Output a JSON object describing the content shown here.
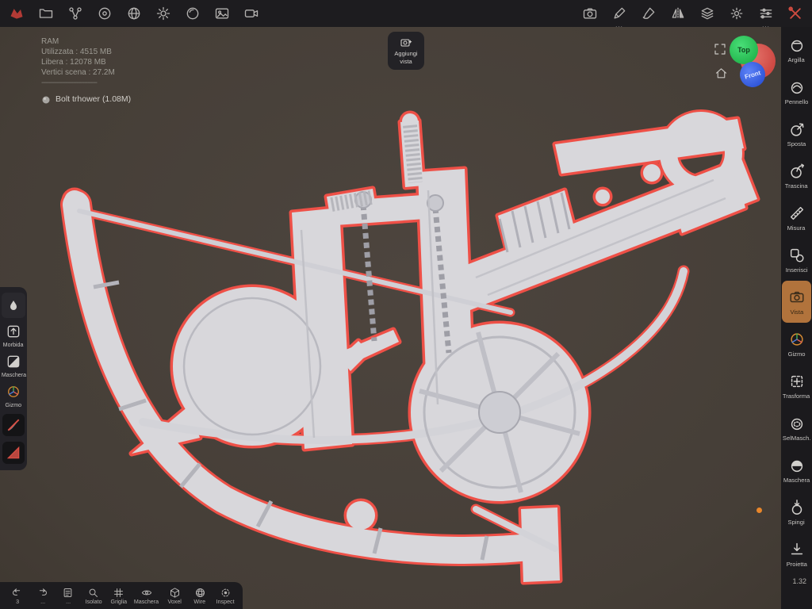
{
  "app": {
    "canvas_bg": "#49413b",
    "panel_bg": "#1d1c1f",
    "selected_tool_bg": "#b1733c",
    "selection_outline_color": "#ee5047",
    "model_fill_color": "#d8d7db"
  },
  "top_toolbar": {
    "left_icons": [
      "app-logo",
      "folder",
      "node-graph",
      "material-sphere",
      "environment-globe",
      "lighting-sun",
      "matcap-sphere",
      "image",
      "camera-video"
    ],
    "right_icons": [
      "screenshot-camera",
      "pencil",
      "paint-brush",
      "symmetry-mirror",
      "layers",
      "settings-gear",
      "adjust-sliders",
      "tools-wrench"
    ],
    "overflow_dots": "..."
  },
  "stats_panel": {
    "ram_title": "RAM",
    "used": "Utilizzata :  4515 MB",
    "free": "Libera :  12078 MB",
    "vertices": "Vertici scena :  27.2M",
    "separator": "------------------------------",
    "object_name": "Bolt trhower (1.08M)"
  },
  "add_view_button": {
    "line1": "Aggiungi",
    "line2": "vista"
  },
  "nav_gizmo": {
    "top_label": "Top",
    "front_label": "Front",
    "top_color": "#2fcb5f",
    "front_color": "#3e6cf5",
    "sphere_color": "#d9534e"
  },
  "right_toolbar": {
    "items": [
      "Argilla",
      "Pennello",
      "Sposta",
      "Trascina",
      "Misura",
      "Inserisci",
      "Vista",
      "Gizmo",
      "Trasforma",
      "SelMasch.",
      "Maschera",
      "Spingi",
      "Proietta"
    ],
    "selected_item": "Vista"
  },
  "left_toolbar": {
    "items": [
      "Morbida",
      "Maschera",
      "Gizmo"
    ]
  },
  "bottom_toolbar": {
    "undo_count": "3",
    "redo_dots": "...",
    "menu_dots": "...",
    "items": [
      "Isolato",
      "Griglia",
      "Maschera",
      "Voxel",
      "Wire",
      "Inspect"
    ]
  },
  "status": {
    "scale_indicator": "1.32"
  }
}
